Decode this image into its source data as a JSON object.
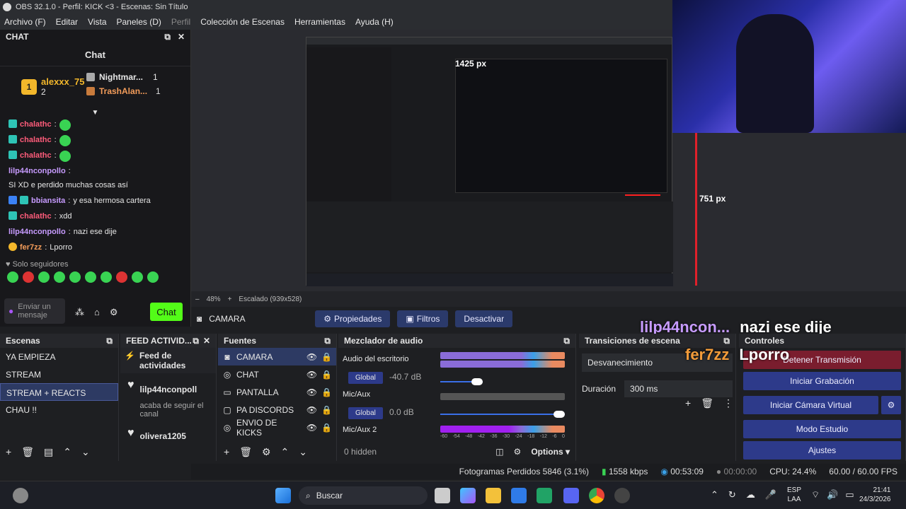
{
  "window": {
    "title": "OBS 32.1.0 - Perfil: KICK <3 - Escenas: Sin Título"
  },
  "menu": {
    "items": [
      "Archivo (F)",
      "Editar",
      "Vista",
      "Paneles (D)",
      "Perfil",
      "Colección de Escenas",
      "Herramientas",
      "Ayuda (H)"
    ]
  },
  "chat": {
    "dock_title": "CHAT",
    "header": "Chat",
    "leaderboard": {
      "first": {
        "rank": "1",
        "name": "alexxx_75",
        "count": "2"
      },
      "second": {
        "name": "Nightmar...",
        "count": "1"
      },
      "third": {
        "name": "TrashAlan...",
        "count": "1"
      }
    },
    "messages": [
      {
        "user": "chalathc",
        "text": ""
      },
      {
        "user": "chalathc",
        "text": ""
      },
      {
        "user": "chalathc",
        "text": ""
      },
      {
        "user": "lilp44nconpollo",
        "text": "SI XD e perdido muchas cosas así"
      },
      {
        "user": "bbiansita",
        "text": "y esa hermosa cartera"
      },
      {
        "user": "chalathc",
        "text": "xdd"
      },
      {
        "user": "lilp44nconpollo",
        "text": "nazi ese dije"
      },
      {
        "user": "fer7zz",
        "text": "Lporro"
      }
    ],
    "followers_only": "Solo seguidores",
    "input_placeholder": "Enviar un mensaje",
    "send_label": "Chat"
  },
  "preview": {
    "zoom": "48%",
    "scale_label": "Escalado (939x528)",
    "measure_1": "1425 px",
    "measure_2": "751 px"
  },
  "source_toolbar": {
    "source_name": "CAMARA",
    "properties": "Propiedades",
    "filters": "Filtros",
    "deactivate": "Desactivar"
  },
  "scenes": {
    "title": "Escenas",
    "items": [
      "YA EMPIEZA",
      "STREAM",
      "STREAM + REACTS",
      "CHAU !!"
    ],
    "selected_index": 2
  },
  "feed": {
    "title": "FEED ACTIVID...",
    "label": "Feed de actividades",
    "entries": [
      {
        "name": "lilp44nconpoll",
        "sub": "acaba de seguir el canal"
      },
      {
        "name": "olivera1205",
        "sub": ""
      }
    ]
  },
  "sources": {
    "title": "Fuentes",
    "items": [
      {
        "name": "CAMARA",
        "icon": "camera-icon"
      },
      {
        "name": "CHAT",
        "icon": "globe-icon"
      },
      {
        "name": "PANTALLA",
        "icon": "monitor-icon"
      },
      {
        "name": "PA DISCORDS",
        "icon": "window-icon"
      },
      {
        "name": "ENVIO DE KICKS",
        "icon": "globe-icon"
      }
    ]
  },
  "mixer": {
    "title": "Mezclador de audio",
    "channels": [
      {
        "name": "Audio del escritorio",
        "db": "-40.7 dB",
        "tag": "Global",
        "level": 0.3
      },
      {
        "name": "Mic/Aux",
        "db": "0.0 dB",
        "tag": "Global",
        "level": 1.0
      },
      {
        "name": "Mic/Aux 2",
        "db": "",
        "tag": "",
        "level": 0
      }
    ],
    "ticks": [
      "-60",
      "-54",
      "-48",
      "-42",
      "-36",
      "-30",
      "-24",
      "-18",
      "-12",
      "-6",
      "0"
    ],
    "hidden": "0 hidden",
    "options": "Options"
  },
  "transitions": {
    "title": "Transiciones de escena",
    "type": "Desvanecimiento",
    "duration_label": "Duración",
    "duration_value": "300 ms"
  },
  "controls": {
    "title": "Controles",
    "stop_stream": "Detener Transmisión",
    "start_rec": "Iniciar Grabación",
    "virtual_cam": "Iniciar Cámara Virtual",
    "studio": "Modo Estudio",
    "settings": "Ajustes"
  },
  "overlay": {
    "line1_user": "lilp44ncon...",
    "line1_msg": "nazi ese dije",
    "line2_user": "fer7zz",
    "line2_msg": "Lporro"
  },
  "status": {
    "frames": "Fotogramas Perdidos 5846 (3.1%)",
    "bitrate": "1558 kbps",
    "live_time": "00:53:09",
    "rec_time": "00:00:00",
    "cpu": "CPU: 24.4%",
    "fps": "60.00 / 60.00 FPS"
  },
  "taskbar": {
    "search": "Buscar",
    "lang1": "ESP",
    "lang2": "LAA",
    "time": "21:41",
    "date": "24/3/2026"
  },
  "colors": {
    "accent": "#2d3a8a",
    "live_red": "#7a1d2e",
    "kick_green": "#53fc18"
  }
}
